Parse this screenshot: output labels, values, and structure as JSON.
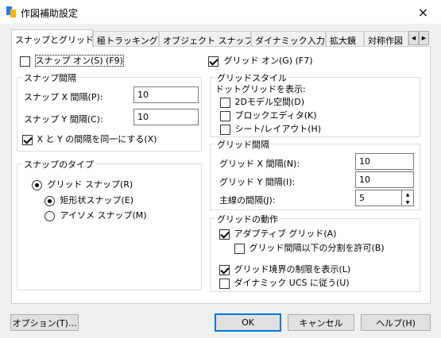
{
  "window": {
    "title": "作図補助設定",
    "close_icon": "×"
  },
  "tabs": [
    {
      "label": "スナップとグリッド",
      "active": true
    },
    {
      "label": "極トラッキング"
    },
    {
      "label": "オブジェクト スナップ"
    },
    {
      "label": "ダイナミック入力"
    },
    {
      "label": "拡大鏡"
    },
    {
      "label": "対称作図"
    }
  ],
  "snap": {
    "snap_on": {
      "label": "スナップ オン(S) (F9)",
      "checked": false
    },
    "spacing": {
      "title": "スナップ間隔",
      "x_label": "スナップ X 間隔(P):",
      "x_value": "10",
      "y_label": "スナップ Y 間隔(C):",
      "y_value": "10",
      "equal_label": "X と Y の間隔を同一にする(X)",
      "equal_checked": true
    },
    "type": {
      "title": "スナップのタイプ",
      "grid_snap": "グリッド スナップ(R)",
      "rect_snap": "矩形状スナップ(E)",
      "iso_snap": "アイソメ スナップ(M)"
    }
  },
  "grid": {
    "grid_on": {
      "label": "グリッド オン(G) (F7)",
      "checked": true
    },
    "style": {
      "title": "グリッドスタイル",
      "subtitle": "ドットグリッドを表示:",
      "model": "2Dモデル空間(D)",
      "block": "ブロックエディタ(K)",
      "sheet": "シート/レイアウト(H)"
    },
    "spacing": {
      "title": "グリッド間隔",
      "x_label": "グリッド X 間隔(N):",
      "x_value": "10",
      "y_label": "グリッド Y 間隔(I):",
      "y_value": "10",
      "major_label": "主線の間隔(J):",
      "major_value": "5"
    },
    "behavior": {
      "title": "グリッドの動作",
      "adaptive": "アダプティブ グリッド(A)",
      "subdivide": "グリッド間隔以下の分割を許可(B)",
      "limits": "グリッド境界の制限を表示(L)",
      "dynamic_ucs": "ダイナミック UCS に従う(U)"
    }
  },
  "buttons": {
    "options": "オプション(T)...",
    "ok": "OK",
    "cancel": "キャンセル",
    "help": "ヘルプ(H)"
  },
  "colors": {
    "accent": "#0078d7"
  }
}
